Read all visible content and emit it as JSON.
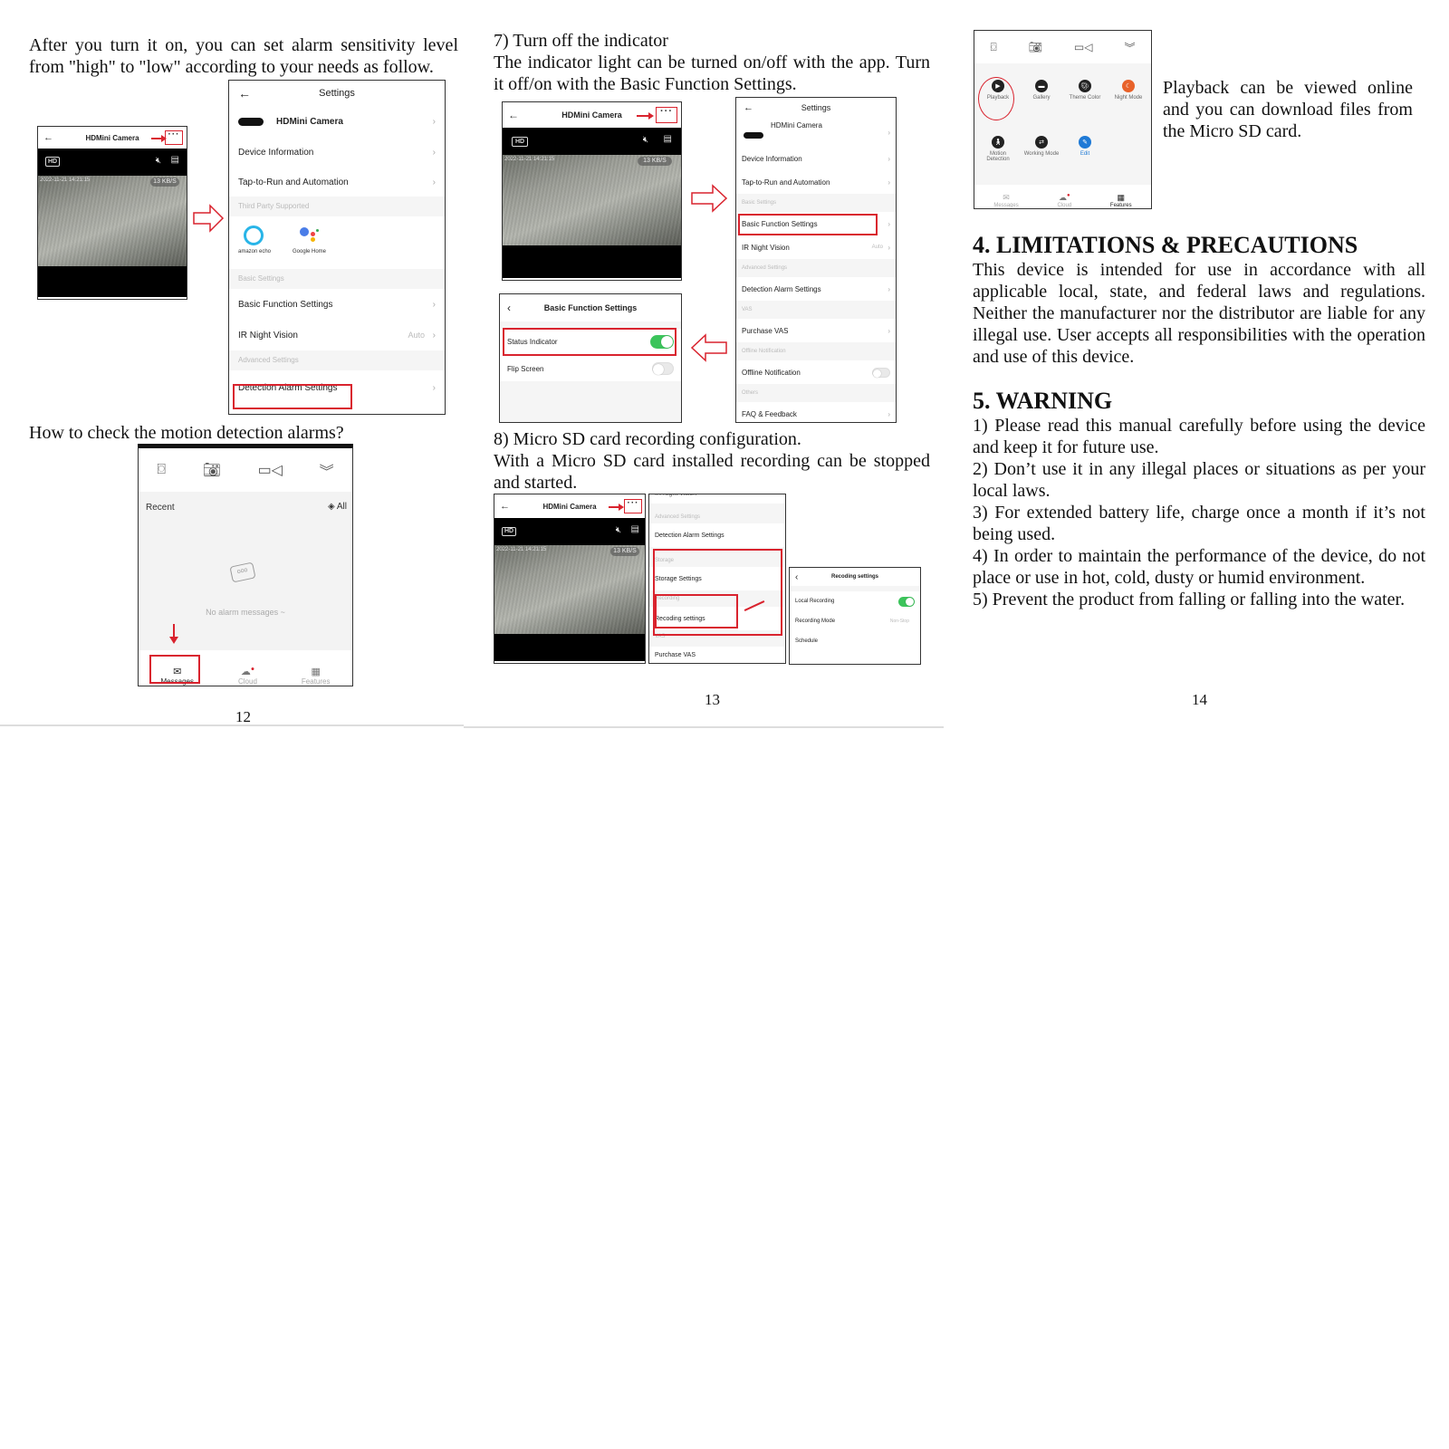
{
  "page12": {
    "intro": "After you turn it on, you can set alarm sensitivity level from \"high\" to \"low\" according to your needs as follow.",
    "camera_screen": {
      "title": "HDMini Camera",
      "hd": "HD",
      "timestamp": "2022-11-21 14:21:15",
      "bitrate": "13 KB/S"
    },
    "settings_screen": {
      "title": "Settings",
      "device_name": "HDMini Camera",
      "rows": [
        {
          "label": "Device Information"
        },
        {
          "label": "Tap-to-Run and Automation"
        }
      ],
      "section_third_party": "Third Party Supported",
      "third_party": [
        {
          "label": "amazon echo"
        },
        {
          "label": "Google Home"
        }
      ],
      "section_basic": "Basic Settings",
      "basic_rows": [
        {
          "label": "Basic Function Settings",
          "value": ""
        },
        {
          "label": "IR Night Vision",
          "value": "Auto"
        }
      ],
      "section_advanced": "Advanced Settings",
      "advanced_rows": [
        {
          "label": "Detection Alarm Settings"
        }
      ]
    },
    "question": "How to check the motion detection alarms?",
    "messages_screen": {
      "recent": "Recent",
      "all": "All",
      "empty": "No alarm messages ~",
      "tabs": [
        {
          "label": "Messages",
          "icon": "envelope-icon"
        },
        {
          "label": "Cloud",
          "icon": "cloud-icon"
        },
        {
          "label": "Features",
          "icon": "grid-icon"
        }
      ]
    },
    "page_number": "12"
  },
  "page13": {
    "heading7": "7) Turn off the indicator",
    "text7": "The indicator light can be turned on/off with the app. Turn it off/on with the Basic Function Settings.",
    "camera_screen": {
      "title": "HDMini Camera",
      "hd": "HD",
      "timestamp": "2022-11-21 14:21:15",
      "bitrate": "13 KB/S"
    },
    "settings_screen": {
      "title": "Settings",
      "device_name": "HDMini Camera",
      "items": [
        {
          "type": "row",
          "label": "Device Information"
        },
        {
          "type": "row",
          "label": "Tap-to-Run and Automation"
        },
        {
          "type": "section",
          "label": "Basic Settings"
        },
        {
          "type": "row",
          "label": "Basic Function Settings",
          "highlight": true
        },
        {
          "type": "row",
          "label": "IR Night Vision",
          "value": "Auto"
        },
        {
          "type": "section",
          "label": "Advanced Settings"
        },
        {
          "type": "row",
          "label": "Detection Alarm Settings"
        },
        {
          "type": "section",
          "label": "VAS"
        },
        {
          "type": "row",
          "label": "Purchase VAS"
        },
        {
          "type": "section",
          "label": "Offline Notification"
        },
        {
          "type": "row",
          "label": "Offline Notification",
          "toggle": false
        },
        {
          "type": "section",
          "label": "Others"
        },
        {
          "type": "row",
          "label": "FAQ & Feedback"
        }
      ]
    },
    "basic_function_screen": {
      "title": "Basic Function Settings",
      "rows": [
        {
          "label": "Status Indicator",
          "on": true
        },
        {
          "label": "Flip Screen",
          "on": false
        }
      ]
    },
    "heading8": "8) Micro SD card recording configuration.",
    "text8": "With a Micro SD card installed recording can be stopped and started.",
    "camera_screen2": {
      "title": "HDMini Camera",
      "hd": "HD",
      "timestamp": "2022-11-21 14:21:15",
      "bitrate": "13 KB/S"
    },
    "storage_screen": {
      "top_partial": "IR Night Vision",
      "section_advanced": "Advanced Settings",
      "detection": "Detection Alarm Settings",
      "section_storage": "Storage",
      "storage": "Storage Settings",
      "section_recording": "Recording",
      "recording": "Recoding settings",
      "section_vas": "VAS",
      "purchase": "Purchase VAS"
    },
    "recording_screen": {
      "title": "Recoding settings",
      "rows": [
        {
          "label": "Local Recording",
          "on": true
        },
        {
          "label": "Recording Mode",
          "value": "Non-Stop"
        },
        {
          "label": "Schedule"
        }
      ]
    },
    "page_number": "13"
  },
  "page14": {
    "features_screen": {
      "features": [
        {
          "label": "Playback",
          "color": "#222222"
        },
        {
          "label": "Gallery",
          "color": "#222222"
        },
        {
          "label": "Theme Color",
          "color": "#222222"
        },
        {
          "label": "Night Mode",
          "color": "#e8622a"
        },
        {
          "label": "Motion Detection",
          "color": "#222222"
        },
        {
          "label": "Working Mode",
          "color": "#222222"
        },
        {
          "label": "Edit",
          "color": "#1f7ad6"
        }
      ],
      "tabs": [
        {
          "label": "Messages"
        },
        {
          "label": "Cloud"
        },
        {
          "label": "Features"
        }
      ]
    },
    "playback_text": "Playback can be viewed online and you can download files from the Micro SD card.",
    "section4_title": "4. LIMITATIONS & PRECAUTIONS",
    "section4_text": "This device is intended for use in accordance with all applicable local, state, and federal laws and regulations. Neither the manufacturer nor the distributor are liable for any illegal use. User accepts all responsibilities with the operation and use of this device.",
    "section5_title": "5. WARNING",
    "warnings": [
      "1) Please read this manual carefully before using the device and keep it for future use.",
      "2) Don’t use it in any illegal places or situations as per your local laws.",
      "3) For extended battery life, charge once a month if it’s not being used.",
      "4) In order to maintain the performance of the device, do not place or use in hot, cold, dusty or humid environment.",
      "5) Prevent the product from falling or falling into the water."
    ],
    "page_number": "14"
  },
  "colors": {
    "highlight_red": "#d9232e",
    "toggle_green": "#3cc45b",
    "night_mode_orange": "#e8622a",
    "edit_blue": "#1f7ad6"
  }
}
